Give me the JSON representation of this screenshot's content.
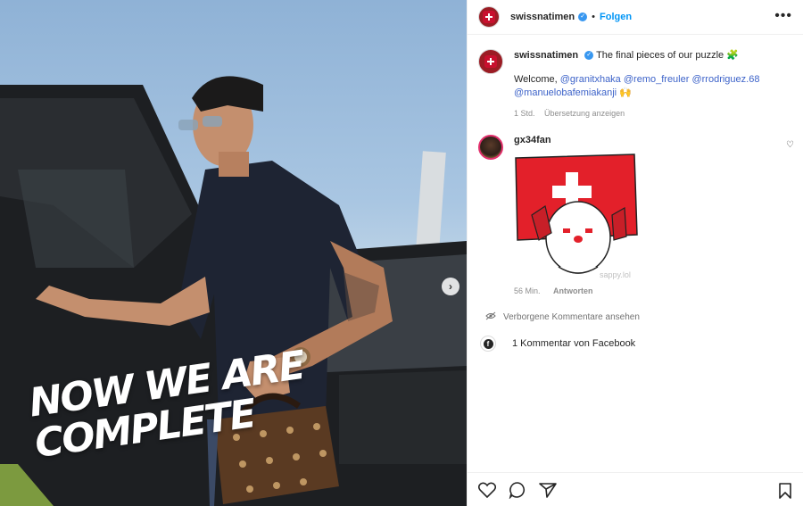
{
  "post": {
    "overlay_line1": "NOW WE ARE",
    "overlay_line2": "COMPLETE"
  },
  "header": {
    "username": "swissnatimen",
    "separator": "•",
    "follow_label": "Folgen",
    "more_label": "•••"
  },
  "caption": {
    "username": "swissnatimen",
    "text": "The final pieces of our puzzle",
    "emoji": "🧩",
    "welcome": "Welcome,",
    "mentions": [
      "@granitxhaka",
      "@remo_freuler",
      "@rrodriguez.68",
      "@manuelobafemiakanji"
    ],
    "end_emoji": "🙌",
    "time": "1 Std.",
    "translate_label": "Übersetzung anzeigen"
  },
  "comment": {
    "username": "gx34fan",
    "sticker_watermark": "sappy.lol",
    "time": "56 Min.",
    "reply_label": "Antworten"
  },
  "hidden_comments_label": "Verborgene Kommentare ansehen",
  "facebook_comments_label": "1 Kommentar von Facebook",
  "colors": {
    "accent_blue": "#0095f6",
    "brand_red": "#c8102e",
    "mention_blue": "#3d63c9"
  }
}
